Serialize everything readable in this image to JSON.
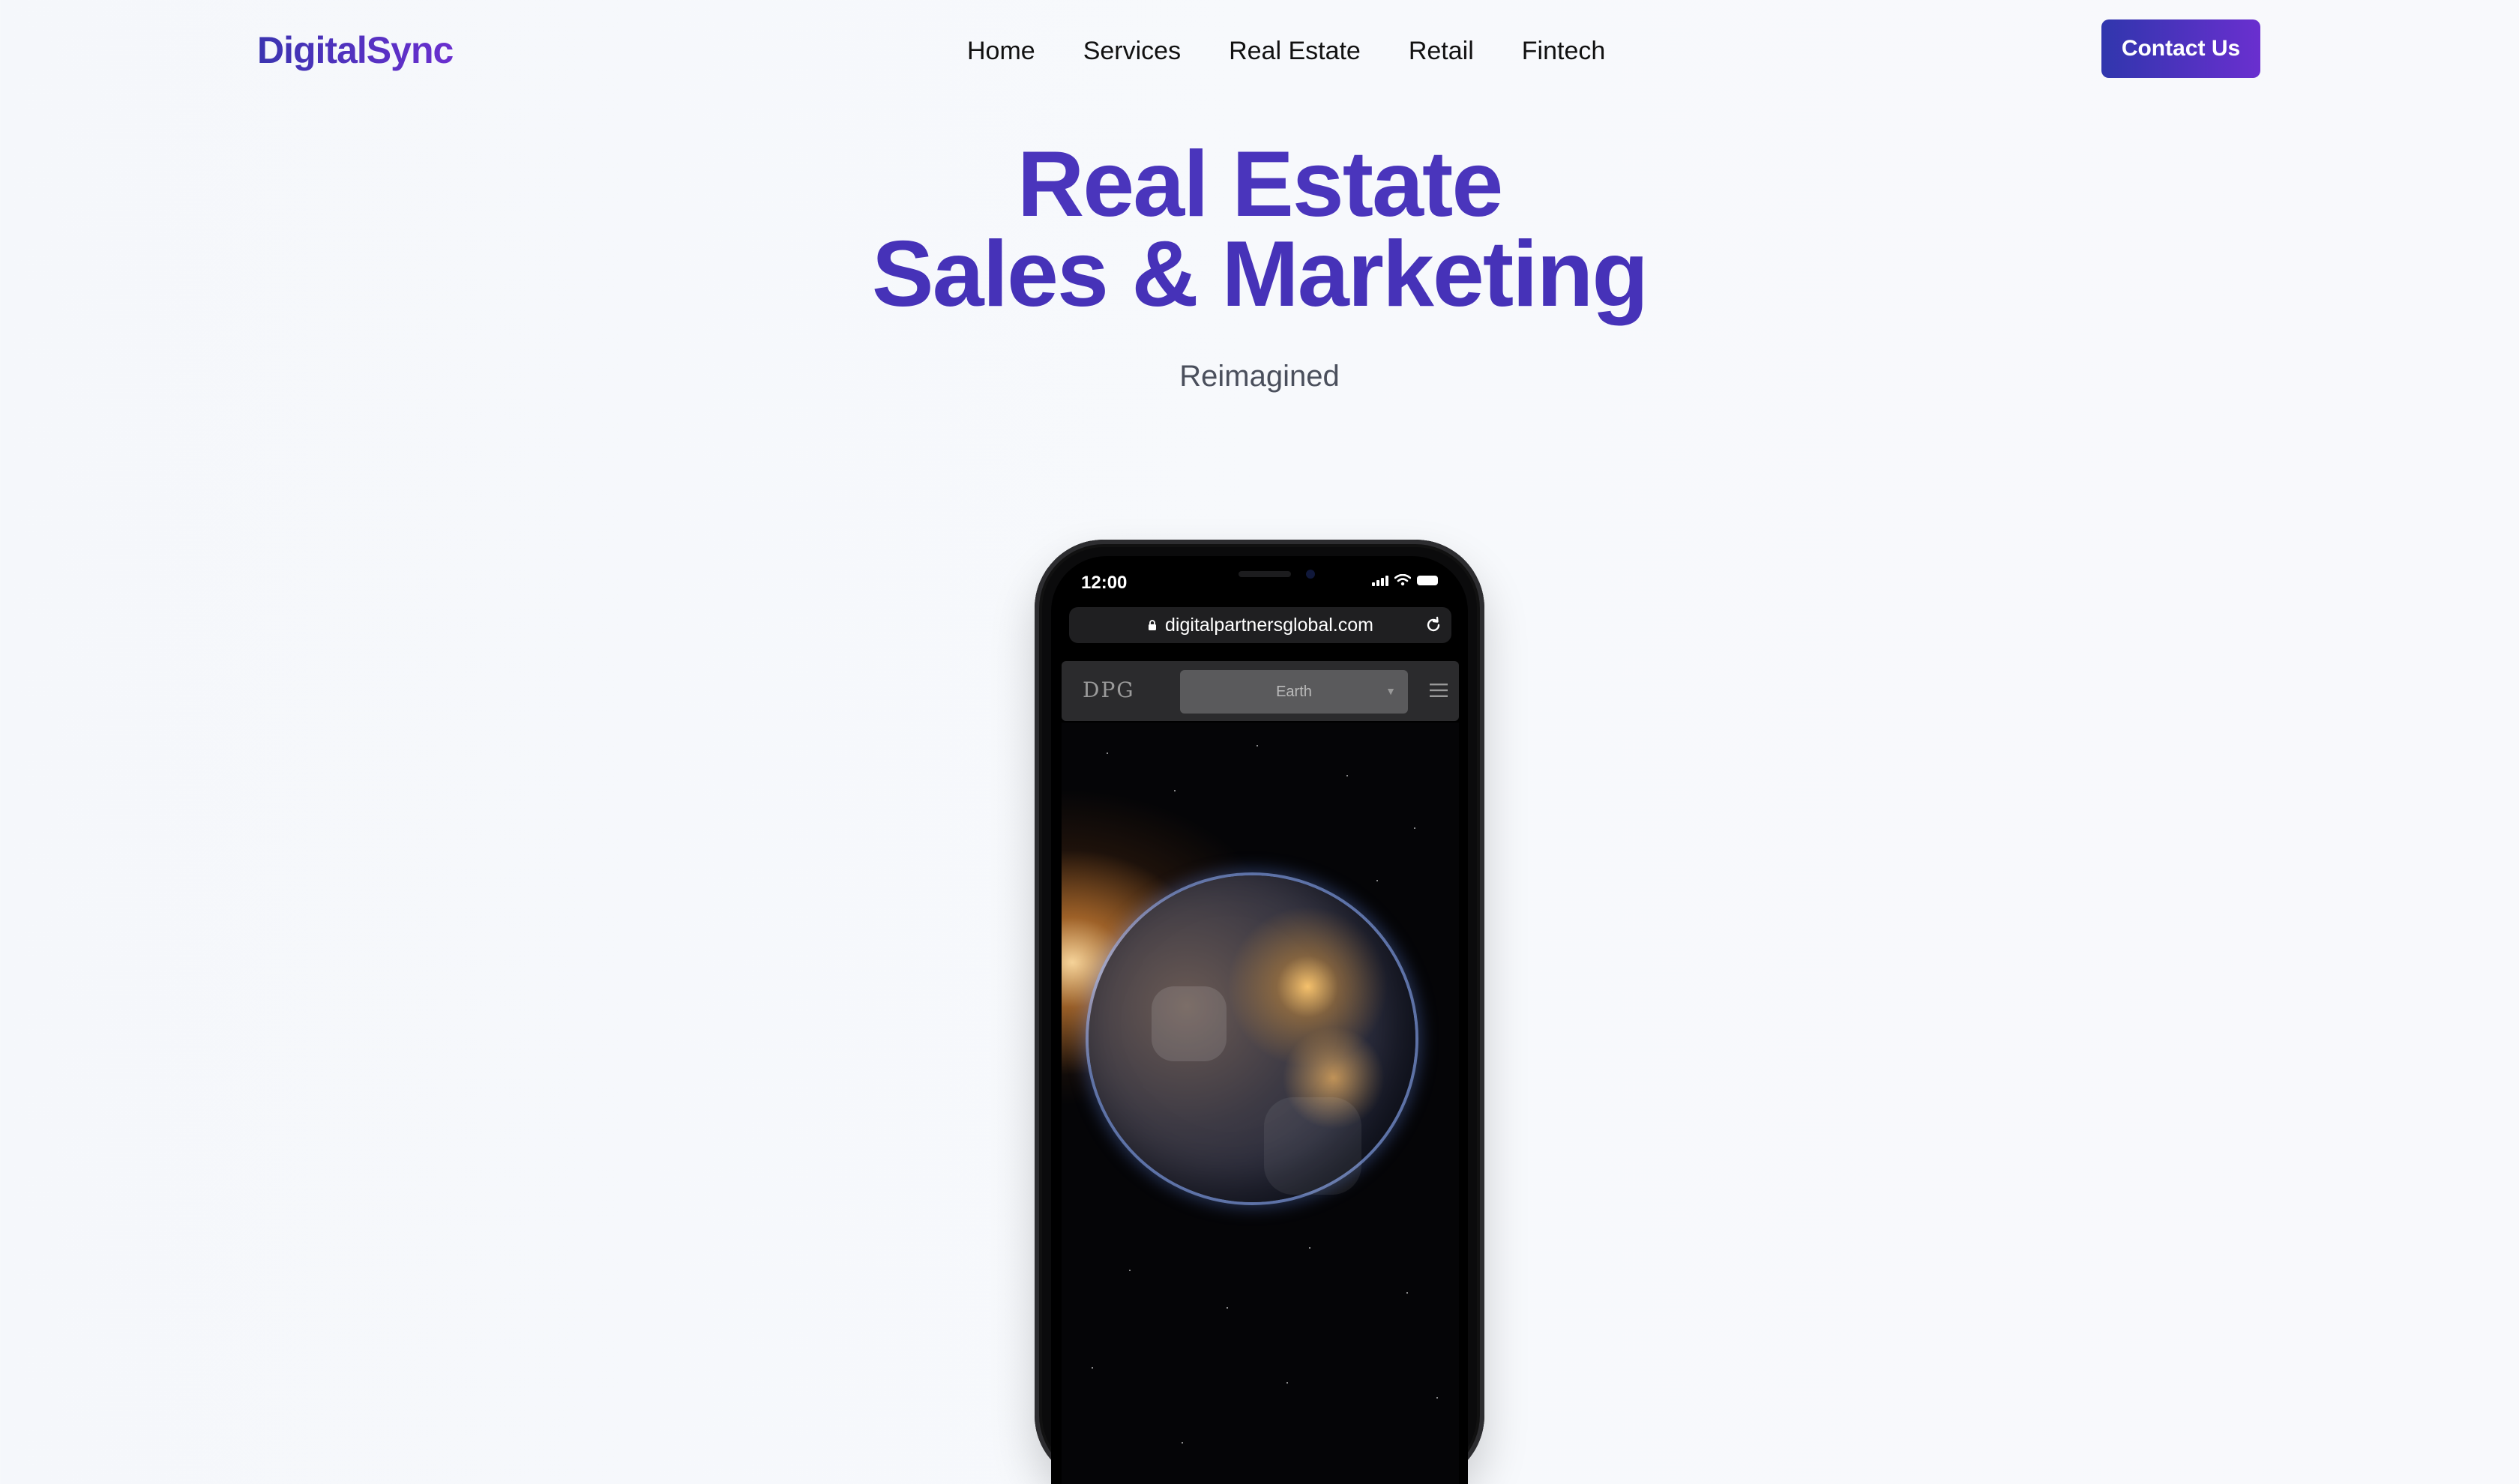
{
  "header": {
    "brand": "DigitalSync",
    "nav": [
      "Home",
      "Services",
      "Real Estate",
      "Retail",
      "Fintech"
    ],
    "cta_label": "Contact Us"
  },
  "hero": {
    "title_line1": "Real Estate",
    "title_line2": "Sales & Marketing",
    "subtitle": "Reimagined"
  },
  "phone": {
    "time": "12:00",
    "url": "digitalpartnersglobal.com",
    "site_logo": "DPG",
    "select_value": "Earth",
    "icons": [
      "signal-icon",
      "wifi-icon",
      "battery-icon",
      "lock-icon",
      "reload-icon",
      "hamburger-menu-icon"
    ]
  },
  "colors": {
    "brand_gradient_start": "#3b34b0",
    "brand_gradient_end": "#6a2fcf",
    "hero_title": "#4a35bc",
    "background": "#f6f8fb"
  }
}
